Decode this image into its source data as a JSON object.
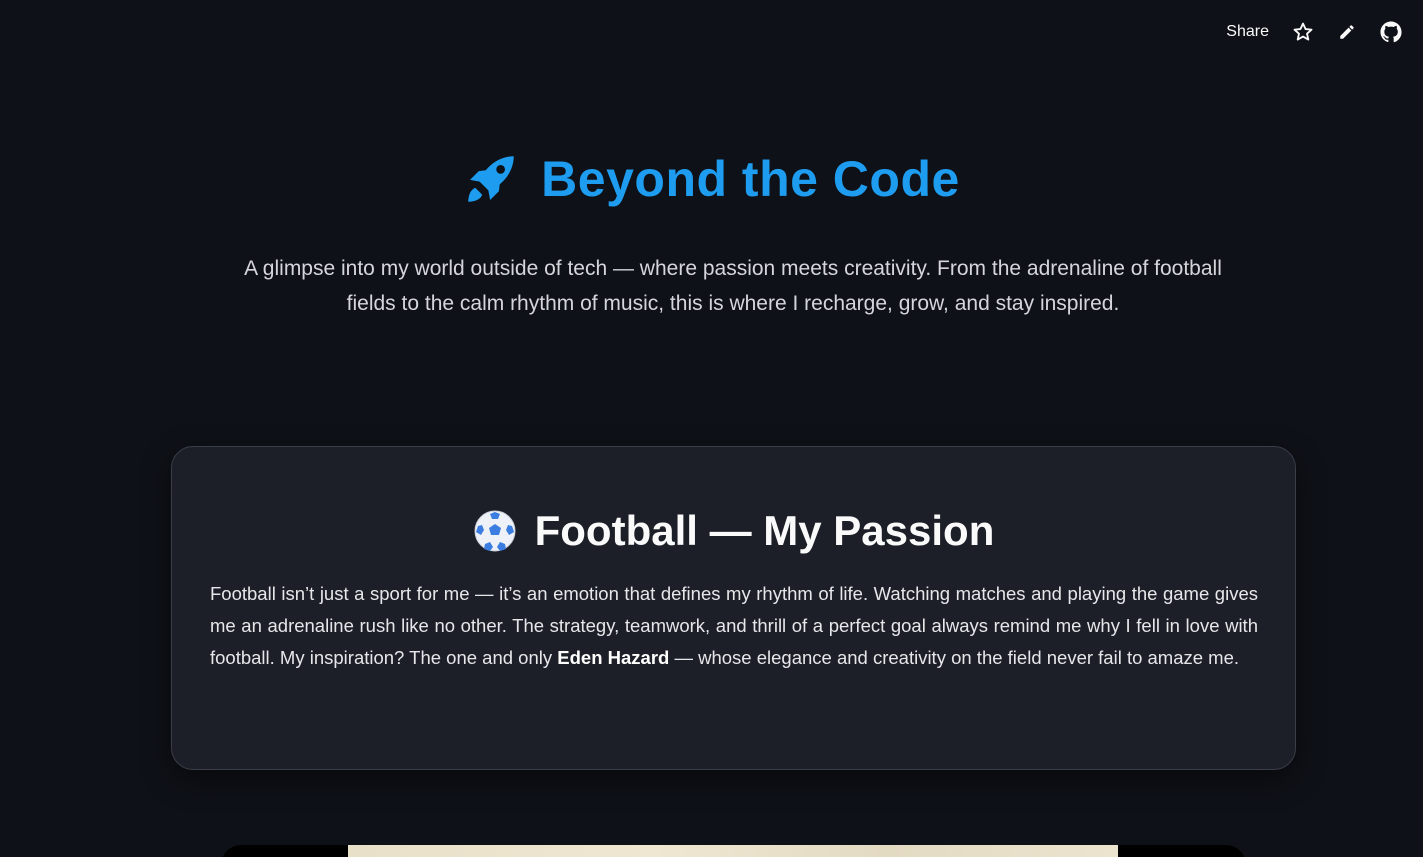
{
  "toolbar": {
    "share_label": "Share",
    "star_icon": "star-icon",
    "edit_icon": "pencil-icon",
    "github_icon": "github-icon"
  },
  "hero": {
    "icon": "rocket-icon",
    "title": "Beyond the Code",
    "subtitle": "A glimpse into my world outside of tech — where passion meets creativity. From the adrenaline of football fields to the calm rhythm of music, this is where I recharge, grow, and stay inspired."
  },
  "football": {
    "icon": "soccer-ball-icon",
    "title": "Football — My Passion",
    "text_before": "Football isn’t just a sport for me — it’s an emotion that defines my rhythm of life. Watching matches and playing the game gives me an adrenaline rush like no other. The strategy, teamwork, and thrill of a perfect goal always remind me why I fell in love with football. My inspiration? The one and only ",
    "highlight": "Eden Hazard",
    "text_after": " — whose elegance and creativity on the field never fail to amaze me."
  },
  "colors": {
    "background": "#0e1117",
    "accent": "#1e9cf0",
    "card": "#1c1f27"
  }
}
